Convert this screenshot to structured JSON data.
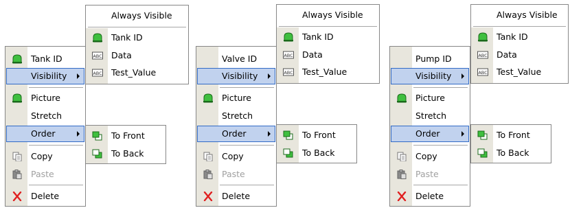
{
  "menus": [
    {
      "main": [
        {
          "label": "Tank ID",
          "icon": "green-tank-icon"
        },
        {
          "label": "Visibility",
          "submenu": true,
          "highlighted": true
        },
        {
          "label": "Picture",
          "icon": "green-tank-icon"
        },
        {
          "label": "Stretch"
        },
        {
          "label": "Order",
          "submenu": true,
          "highlighted": true
        },
        {
          "label": "Copy",
          "icon": "copy-icon"
        },
        {
          "label": "Paste",
          "icon": "paste-icon",
          "disabled": true
        },
        {
          "label": "Delete",
          "icon": "delete-x-icon"
        }
      ],
      "visibility_sub": [
        {
          "label": "Always Visible"
        },
        {
          "label": "Tank ID",
          "icon": "green-tank-icon"
        },
        {
          "label": "Data",
          "icon": "abc-text-icon"
        },
        {
          "label": "Test_Value",
          "icon": "abc-text-icon"
        }
      ],
      "order_sub": [
        {
          "label": "To Front",
          "icon": "bring-to-front-icon"
        },
        {
          "label": "To Back",
          "icon": "send-to-back-icon"
        }
      ]
    },
    {
      "main": [
        {
          "label": "Valve ID"
        },
        {
          "label": "Visibility",
          "submenu": true,
          "highlighted": true
        },
        {
          "label": "Picture",
          "icon": "green-tank-icon"
        },
        {
          "label": "Stretch"
        },
        {
          "label": "Order",
          "submenu": true,
          "highlighted": true
        },
        {
          "label": "Copy",
          "icon": "copy-icon"
        },
        {
          "label": "Paste",
          "icon": "paste-icon",
          "disabled": true
        },
        {
          "label": "Delete",
          "icon": "delete-x-icon"
        }
      ],
      "visibility_sub": [
        {
          "label": "Always Visible"
        },
        {
          "label": "Tank ID",
          "icon": "green-tank-icon"
        },
        {
          "label": "Data",
          "icon": "abc-text-icon"
        },
        {
          "label": "Test_Value",
          "icon": "abc-text-icon"
        }
      ],
      "order_sub": [
        {
          "label": "To Front",
          "icon": "bring-to-front-icon"
        },
        {
          "label": "To Back",
          "icon": "send-to-back-icon"
        }
      ]
    },
    {
      "main": [
        {
          "label": "Pump ID"
        },
        {
          "label": "Visibility",
          "submenu": true,
          "highlighted": true
        },
        {
          "label": "Picture",
          "icon": "green-tank-icon"
        },
        {
          "label": "Stretch"
        },
        {
          "label": "Order",
          "submenu": true,
          "highlighted": true
        },
        {
          "label": "Copy",
          "icon": "copy-icon"
        },
        {
          "label": "Paste",
          "icon": "paste-icon",
          "disabled": true
        },
        {
          "label": "Delete",
          "icon": "delete-x-icon"
        }
      ],
      "visibility_sub": [
        {
          "label": "Always Visible"
        },
        {
          "label": "Tank ID",
          "icon": "green-tank-icon"
        },
        {
          "label": "Data",
          "icon": "abc-text-icon"
        },
        {
          "label": "Test_Value",
          "icon": "abc-text-icon"
        }
      ],
      "order_sub": [
        {
          "label": "To Front",
          "icon": "bring-to-front-icon"
        },
        {
          "label": "To Back",
          "icon": "send-to-back-icon"
        }
      ]
    }
  ],
  "colors": {
    "highlight_fill": "#c1d2ee",
    "highlight_border": "#316ac5",
    "gutter": "#e8e6dd",
    "tank_green": "#3fbf3f",
    "delete_red": "#e02020",
    "disabled_text": "#a0a0a0"
  }
}
